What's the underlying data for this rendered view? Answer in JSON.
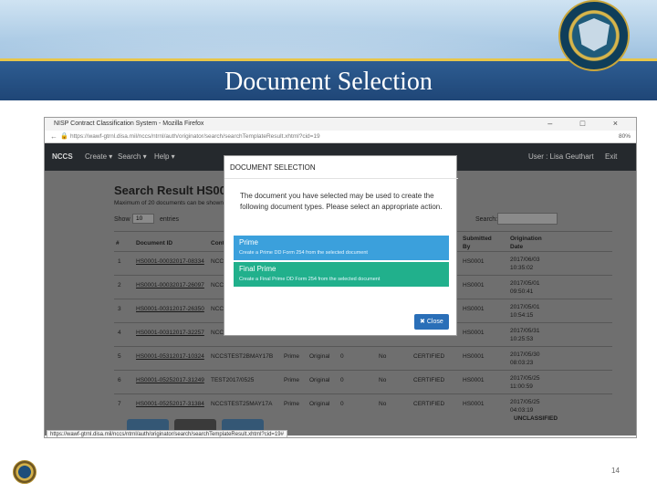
{
  "slide": {
    "title": "Document Selection",
    "page_number": "14"
  },
  "browser": {
    "window_title": "NISP Contract Classification System - Mozilla Firefox",
    "window_controls": "– □ ×",
    "url": "https://wawf-gtrnl.disa.mil/nccs/ntrnl/auth/originator/search/searchTemplateResult.xhtml?cid=19",
    "zoom": "80%",
    "status_url": "https://wawf-gtrnl.disa.mil/nccs/ntrnl/auth/originator/search/searchTemplateResult.xhtml?cid=19#"
  },
  "nav": {
    "brand": "NCCS",
    "items": [
      "Create ▾",
      "Search ▾",
      "Help ▾"
    ],
    "user": "User : Lisa Geuthart",
    "exit": "Exit"
  },
  "page": {
    "heading": "Search Result HS0001 (",
    "subtext": "Maximum of 20 documents can be shown",
    "show_label": "Show",
    "show_value": "10",
    "entries_label": "entries",
    "search_label": "Search:",
    "columns": [
      "#",
      "Document ID",
      "Contr",
      "Submitted By",
      "Origination Date"
    ],
    "rows": [
      {
        "n": "1",
        "doc": "HS0001-00032017-08334",
        "contr": "NCCS",
        "sub": "HS0001",
        "date": "2017/06/03 10:35:02"
      },
      {
        "n": "2",
        "doc": "HS0001-00032017-26097",
        "contr": "NCCS",
        "sub": "HS0001",
        "date": "2017/05/01 09:50:41"
      },
      {
        "n": "3",
        "doc": "HS0001-00312017-26350",
        "contr": "NCCS",
        "sub": "HS0001",
        "date": "2017/05/01 10:54:15"
      },
      {
        "n": "4",
        "doc": "HS0001-00312017-32257",
        "contr": "NCCS",
        "sub": "HS0001",
        "date": "2017/05/31 10:25:53"
      },
      {
        "n": "5",
        "doc": "HS0001-05312017-10324",
        "contr": "NCCSTEST2BMAY17B",
        "type": "Prime",
        "orig": "Original",
        "zero": "0",
        "no": "No",
        "status": "CERTIFIED",
        "sub": "HS0001",
        "date": "2017/05/30 08:03:23"
      },
      {
        "n": "6",
        "doc": "HS0001-05252017-31249",
        "contr": "TEST2017/0525",
        "type": "Prime",
        "orig": "Original",
        "zero": "0",
        "no": "No",
        "status": "CERTIFIED",
        "sub": "HS0001",
        "date": "2017/05/25 11:00:59"
      },
      {
        "n": "7",
        "doc": "HS0001-05252017-31384",
        "contr": "NCCSTEST25MAY17A",
        "type": "Prime",
        "orig": "Original",
        "zero": "0",
        "no": "No",
        "status": "CERTIFIED",
        "sub": "HS0001",
        "date": "2017/05/25 04:03:19"
      }
    ],
    "classification": "UNCLASSIFIED"
  },
  "modal": {
    "title": "DOCUMENT SELECTION",
    "body": "The document you have selected may be used to create the following document types. Please select an appropriate action.",
    "options": [
      {
        "title": "Prime",
        "desc": "Create a Prime DD Form 254 from the selected document",
        "color": "#3ba0dc"
      },
      {
        "title": "Final Prime",
        "desc": "Create a Final Prime DD Form 254 from the selected document",
        "color": "#21b08c"
      }
    ],
    "close_label": "Close"
  }
}
